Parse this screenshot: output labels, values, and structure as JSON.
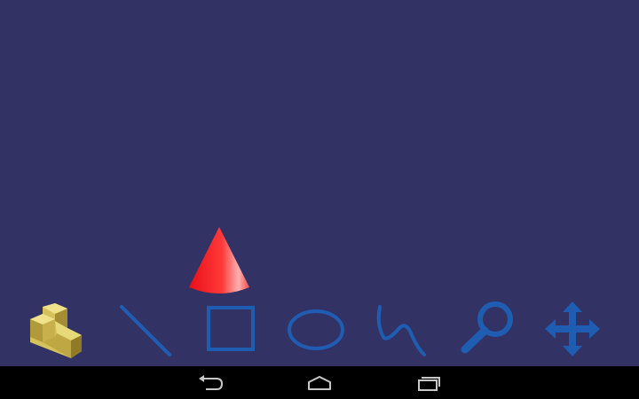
{
  "app": {
    "background_color": "#323264",
    "accent_color": "#1f5db3"
  },
  "canvas": {
    "object": {
      "name": "cone-icon",
      "color": "#ff2a2a"
    }
  },
  "toolbar": {
    "tools": [
      {
        "name": "solid-shape-icon",
        "color": "#c9b24a"
      },
      {
        "name": "line-tool-icon"
      },
      {
        "name": "rectangle-tool-icon"
      },
      {
        "name": "ellipse-tool-icon"
      },
      {
        "name": "freehand-curve-tool-icon"
      },
      {
        "name": "magnifier-zoom-icon"
      },
      {
        "name": "move-arrows-icon"
      }
    ]
  },
  "navbar": {
    "buttons": [
      {
        "name": "back-icon"
      },
      {
        "name": "home-icon"
      },
      {
        "name": "recent-apps-icon"
      }
    ]
  }
}
